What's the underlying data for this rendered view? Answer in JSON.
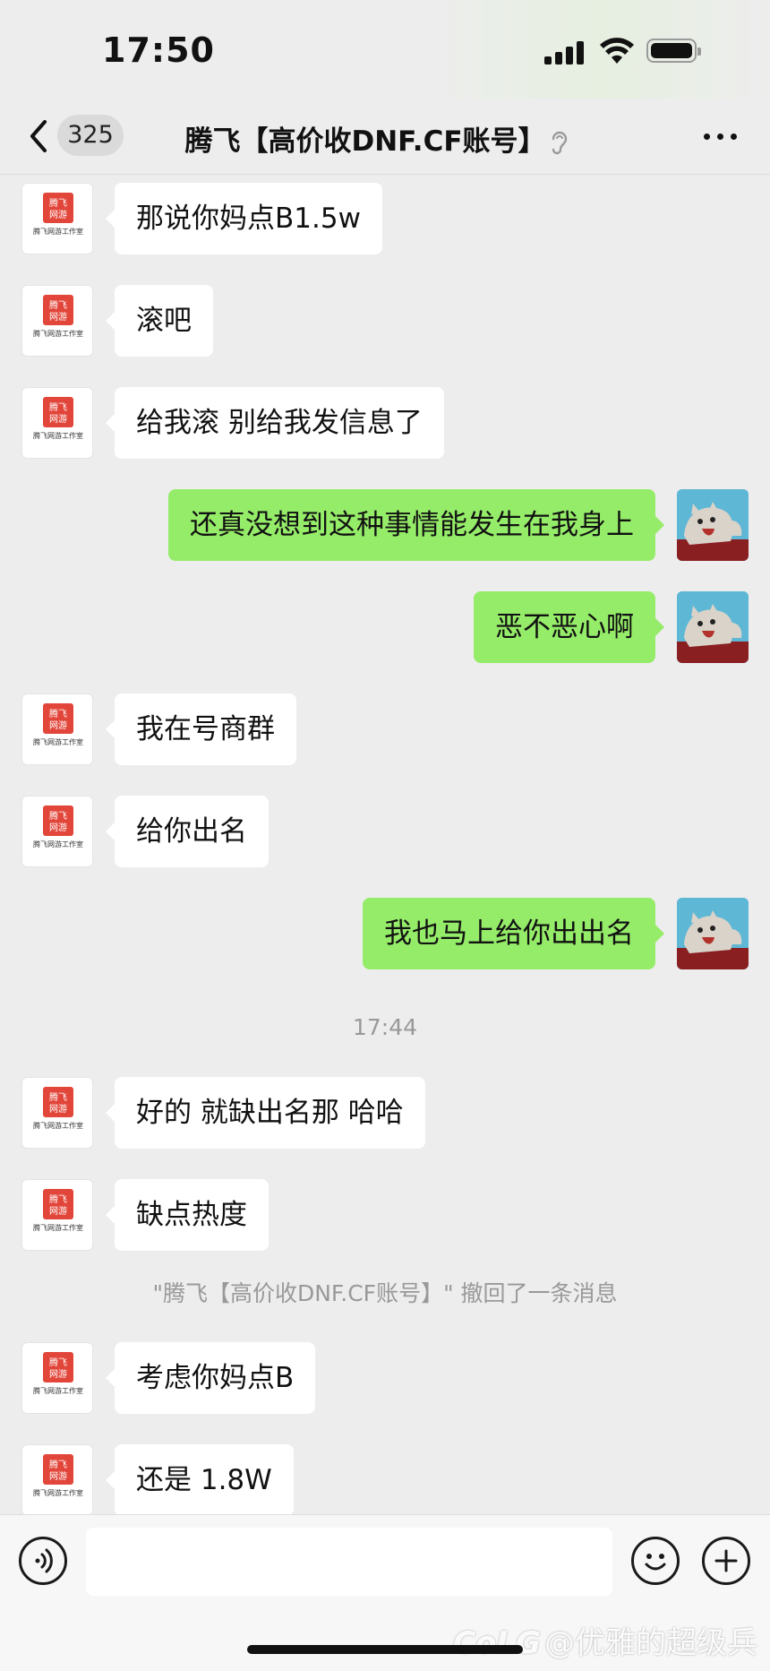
{
  "status_bar": {
    "time": "17:50"
  },
  "header": {
    "unread_count": "325",
    "title": "腾飞【高价收DNF.CF账号】"
  },
  "avatars": {
    "contact_logo_text": "腾飞\n网游",
    "contact_studio_text": "腾飞网游工作室"
  },
  "messages": [
    {
      "side": "in",
      "text": "那说你妈点B1.5w"
    },
    {
      "side": "in",
      "text": "滚吧"
    },
    {
      "side": "in",
      "text": "给我滚 别给我发信息了"
    },
    {
      "side": "out",
      "text": "还真没想到这种事情能发生在我身上"
    },
    {
      "side": "out",
      "text": "恶不恶心啊"
    },
    {
      "side": "in",
      "text": "我在号商群"
    },
    {
      "side": "in",
      "text": "给你出名"
    },
    {
      "side": "out",
      "text": "我也马上给你出出名"
    },
    {
      "side": "time",
      "text": "17:44"
    },
    {
      "side": "in",
      "text": "好的 就缺出名那 哈哈"
    },
    {
      "side": "in",
      "text": "缺点热度"
    },
    {
      "side": "system",
      "text": "\"腾飞【高价收DNF.CF账号】\" 撤回了一条消息"
    },
    {
      "side": "in",
      "text": "考虑你妈点B"
    },
    {
      "side": "in",
      "text": "还是 1.8W"
    }
  ],
  "input": {
    "placeholder": ""
  },
  "watermark": "@优雅的超级兵",
  "watermark_prefix": "CoLG"
}
